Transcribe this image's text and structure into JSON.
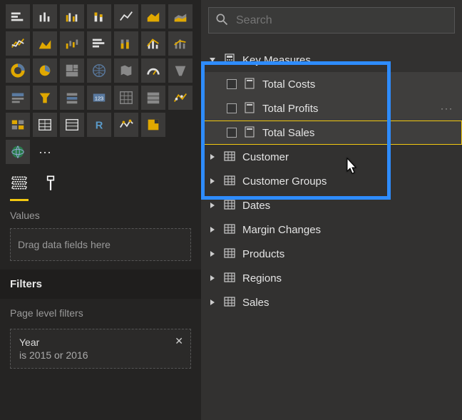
{
  "viz_icons": [
    "stacked-bar",
    "column",
    "line-clustered",
    "line-stacked",
    "line",
    "area",
    "stacked-area",
    "ribbon",
    "area-chart",
    "waterfall",
    "clustered-bar",
    "stacked-column",
    "line-col",
    "line-col2",
    "donut",
    "pie",
    "treemap",
    "map",
    "filled-map",
    "gauge",
    "funnel",
    "card",
    "kpi",
    "slicer",
    "matrix",
    "table",
    "multi-row",
    "scatter",
    "bubble",
    "grid",
    "table2",
    "r-visual",
    "line2",
    "python"
  ],
  "globe_icon": "arcgis",
  "more_icon": "···",
  "tabs": {
    "fields_icon": "fields-icon",
    "format_icon": "format-icon"
  },
  "values": {
    "label": "Values",
    "placeholder": "Drag data fields here"
  },
  "filters": {
    "header": "Filters",
    "page_label": "Page level filters",
    "chip_title": "Year",
    "chip_sub": "is 2015 or 2016",
    "chip_close": "✕"
  },
  "search": {
    "placeholder": "Search"
  },
  "tree": {
    "key_measures": {
      "label": "Key Measures"
    },
    "total_costs": {
      "label": "Total Costs"
    },
    "total_profits": {
      "label": "Total Profits"
    },
    "total_sales": {
      "label": "Total Sales"
    },
    "customer": {
      "label": "Customer"
    },
    "customer_groups": {
      "label": "Customer Groups"
    },
    "dates": {
      "label": "Dates"
    },
    "margin_changes": {
      "label": "Margin Changes"
    },
    "products": {
      "label": "Products"
    },
    "regions": {
      "label": "Regions"
    },
    "sales": {
      "label": "Sales"
    }
  }
}
